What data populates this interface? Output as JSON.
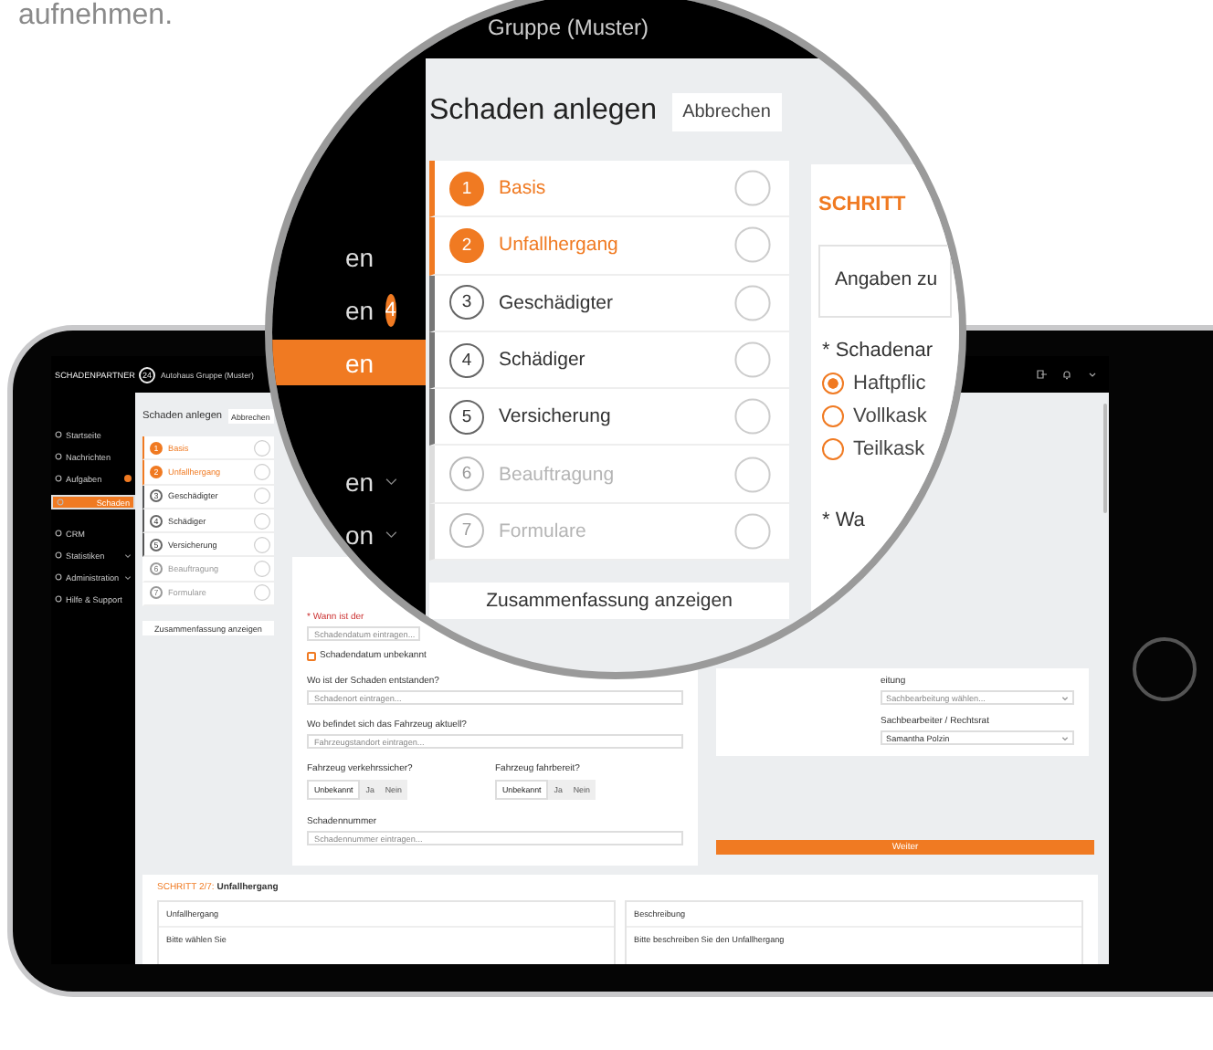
{
  "caption": "aufnehmen.",
  "app": {
    "logo": "SCHADENPARTNER",
    "logo_badge": "24",
    "company": "Autohaus Gruppe (Muster)",
    "sidebar": [
      {
        "label": "Startseite",
        "selected": false,
        "badge": false,
        "expandable": false
      },
      {
        "label": "Nachrichten",
        "selected": false,
        "badge": false,
        "expandable": false
      },
      {
        "label": "Aufgaben",
        "selected": false,
        "badge": true,
        "expandable": false
      },
      {
        "label": "Schaden",
        "selected": true,
        "badge": false,
        "expandable": false
      },
      {
        "label": "CRM",
        "selected": false,
        "badge": false,
        "expandable": false
      },
      {
        "label": "Statistiken",
        "selected": false,
        "badge": false,
        "expandable": true
      },
      {
        "label": "Administration",
        "selected": false,
        "badge": false,
        "expandable": true
      },
      {
        "label": "Hilfe & Support",
        "selected": false,
        "badge": false,
        "expandable": false
      }
    ],
    "title": "Schaden anlegen",
    "cancel": "Abbrechen",
    "steps": [
      {
        "number": "1",
        "label": "Basis",
        "done": true,
        "disabled": false
      },
      {
        "number": "2",
        "label": "Unfallhergang",
        "done": true,
        "disabled": false
      },
      {
        "number": "3",
        "label": "Geschädigter",
        "done": false,
        "disabled": false
      },
      {
        "number": "4",
        "label": "Schädiger",
        "done": false,
        "disabled": false
      },
      {
        "number": "5",
        "label": "Versicherung",
        "done": false,
        "disabled": false
      },
      {
        "number": "6",
        "label": "Beauftragung",
        "done": false,
        "disabled": true
      },
      {
        "number": "7",
        "label": "Formulare",
        "done": false,
        "disabled": true
      }
    ],
    "summary_button": "Zusammenfassung anzeigen",
    "form": {
      "date_label": "* Wann ist der",
      "date_placeholder": "Schadendatum eintragen...",
      "date_unknown": {
        "label": "Schadendatum unbekannt",
        "checked": false
      },
      "fields": [
        {
          "label": "Wo ist der Schaden entstanden?",
          "placeholder": "Schadenort eintragen..."
        },
        {
          "label": "Wo befindet sich das Fahrzeug aktuell?",
          "placeholder": "Fahrzeugstandort eintragen..."
        }
      ],
      "toggles": [
        {
          "label": "Fahrzeug verkehrssicher?",
          "options": [
            {
              "label": "Unbekannt",
              "selected": true
            },
            {
              "label": "Ja",
              "selected": false
            },
            {
              "label": "Nein",
              "selected": false
            }
          ]
        },
        {
          "label": "Fahrzeug fahrbereit?",
          "options": [
            {
              "label": "Unbekannt",
              "selected": true
            },
            {
              "label": "Ja",
              "selected": false
            },
            {
              "label": "Nein",
              "selected": false
            }
          ]
        }
      ],
      "number_label": "Schadennummer",
      "number_placeholder": "Schadennummer eintragen..."
    },
    "assignment": {
      "handling_label": "eitung",
      "handling_placeholder": "Sachbearbeitung wählen...",
      "clerk_label": "Sachbearbeiter / Rechtsrat",
      "clerk_value": "Samantha Polzin"
    },
    "next_button": "Weiter",
    "section2": {
      "step": "SCHRITT 2/7:",
      "title": "Unfallhergang",
      "cards": [
        {
          "title": "Unfallhergang",
          "text": "Bitte wählen Sie"
        },
        {
          "title": "Beschreibung",
          "text": "Bitte beschreiben Sie den Unfallhergang"
        }
      ]
    }
  },
  "magnifier": {
    "company": "Gruppe (Muster)",
    "sidebar": [
      {
        "label": "en",
        "selected": false,
        "expandable": false
      },
      {
        "label": "en",
        "selected": false,
        "badge": "4",
        "expandable": false
      },
      {
        "label": "en",
        "selected": true,
        "expandable": false
      },
      {
        "label": "en",
        "selected": false,
        "expandable": true
      },
      {
        "label": "on",
        "selected": false,
        "expandable": true
      }
    ],
    "title": "Schaden anlegen",
    "cancel": "Abbrechen",
    "steps": [
      {
        "number": "1",
        "label": "Basis",
        "done": true,
        "disabled": false
      },
      {
        "number": "2",
        "label": "Unfallhergang",
        "done": true,
        "disabled": false
      },
      {
        "number": "3",
        "label": "Geschädigter",
        "done": false,
        "disabled": false
      },
      {
        "number": "4",
        "label": "Schädiger",
        "done": false,
        "disabled": false
      },
      {
        "number": "5",
        "label": "Versicherung",
        "done": false,
        "disabled": false
      },
      {
        "number": "6",
        "label": "Beauftragung",
        "done": false,
        "disabled": true
      },
      {
        "number": "7",
        "label": "Formulare",
        "done": false,
        "disabled": true
      }
    ],
    "summary_button": "Zusammenfassung anzeigen",
    "step_heading": "SCHRITT",
    "card_title": "Angaben zu",
    "type_label": "* Schadenar",
    "options": [
      {
        "label": "Haftpflic",
        "selected": true
      },
      {
        "label": "Vollkask",
        "selected": false
      },
      {
        "label": "Teilkask",
        "selected": false
      }
    ],
    "when_label": "* Wa"
  }
}
